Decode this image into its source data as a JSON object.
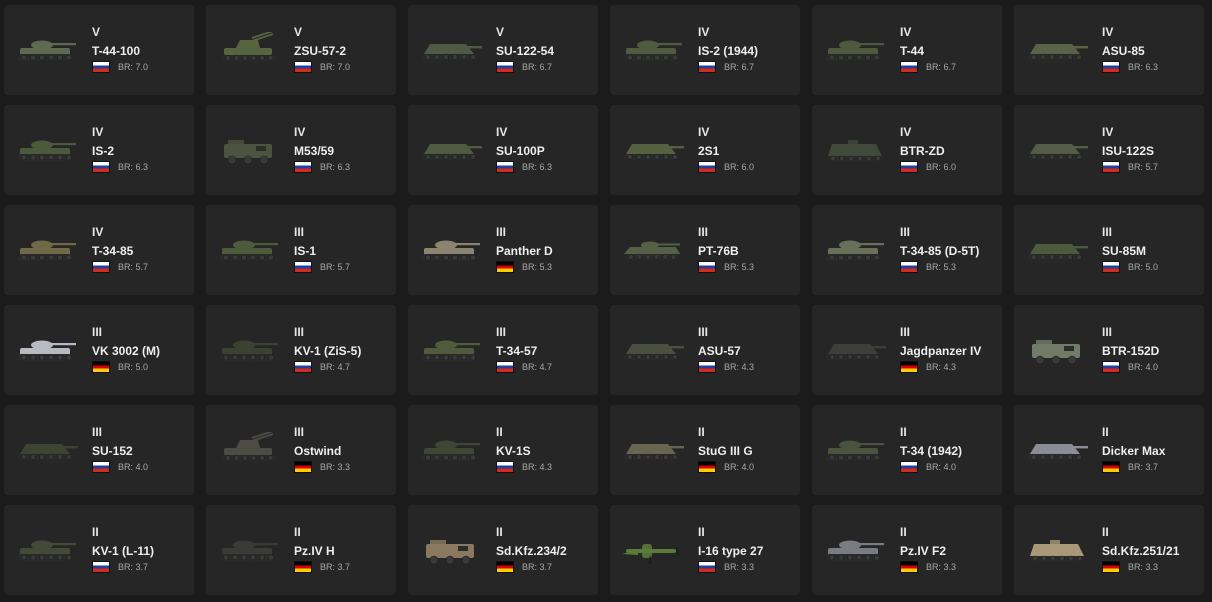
{
  "br_prefix": "BR: ",
  "nations": {
    "ussr": {
      "flag": "ussr-flag-icon",
      "colors": [
        "#ffffff",
        "#1c3fa0",
        "#d52b1e"
      ]
    },
    "germany": {
      "flag": "germany-flag-icon",
      "colors": [
        "#000000",
        "#dd0000",
        "#ffce00"
      ]
    }
  },
  "vehicles": [
    {
      "rank": "V",
      "name": "T-44-100",
      "nation": "ussr",
      "br": "7.0",
      "kind": "tank",
      "color": "#5e6b52"
    },
    {
      "rank": "V",
      "name": "ZSU-57-2",
      "nation": "ussr",
      "br": "7.0",
      "kind": "spaa",
      "color": "#56643f"
    },
    {
      "rank": "V",
      "name": "SU-122-54",
      "nation": "ussr",
      "br": "6.7",
      "kind": "td",
      "color": "#4e5a44"
    },
    {
      "rank": "IV",
      "name": "IS-2 (1944)",
      "nation": "ussr",
      "br": "6.7",
      "kind": "tank",
      "color": "#505c40"
    },
    {
      "rank": "IV",
      "name": "T-44",
      "nation": "ussr",
      "br": "6.7",
      "kind": "tank",
      "color": "#4d5a3e"
    },
    {
      "rank": "IV",
      "name": "ASU-85",
      "nation": "ussr",
      "br": "6.3",
      "kind": "td",
      "color": "#596348"
    },
    {
      "rank": "IV",
      "name": "IS-2",
      "nation": "ussr",
      "br": "6.3",
      "kind": "tank",
      "color": "#4c5a3c"
    },
    {
      "rank": "IV",
      "name": "M53/59",
      "nation": "ussr",
      "br": "6.3",
      "kind": "truck",
      "color": "#4c5440"
    },
    {
      "rank": "IV",
      "name": "SU-100P",
      "nation": "ussr",
      "br": "6.3",
      "kind": "spg",
      "color": "#4f5a40"
    },
    {
      "rank": "IV",
      "name": "2S1",
      "nation": "ussr",
      "br": "6.0",
      "kind": "spg",
      "color": "#55603e"
    },
    {
      "rank": "IV",
      "name": "BTR-ZD",
      "nation": "ussr",
      "br": "6.0",
      "kind": "apc",
      "color": "#3f4a3b"
    },
    {
      "rank": "IV",
      "name": "ISU-122S",
      "nation": "ussr",
      "br": "5.7",
      "kind": "td",
      "color": "#545c48"
    },
    {
      "rank": "IV",
      "name": "T-34-85",
      "nation": "ussr",
      "br": "5.7",
      "kind": "tank",
      "color": "#6f6a45"
    },
    {
      "rank": "III",
      "name": "IS-1",
      "nation": "ussr",
      "br": "5.7",
      "kind": "tank",
      "color": "#4d5a3c"
    },
    {
      "rank": "III",
      "name": "Panther D",
      "nation": "germany",
      "br": "5.3",
      "kind": "tank",
      "color": "#8a8470"
    },
    {
      "rank": "III",
      "name": "PT-76B",
      "nation": "ussr",
      "br": "5.3",
      "kind": "light",
      "color": "#566046"
    },
    {
      "rank": "III",
      "name": "T-34-85 (D-5T)",
      "nation": "ussr",
      "br": "5.3",
      "kind": "tank",
      "color": "#6a6f5a"
    },
    {
      "rank": "III",
      "name": "SU-85M",
      "nation": "ussr",
      "br": "5.0",
      "kind": "td",
      "color": "#4e5a3e"
    },
    {
      "rank": "III",
      "name": "VK 3002 (M)",
      "nation": "germany",
      "br": "5.0",
      "kind": "tank",
      "color": "#b8bac2"
    },
    {
      "rank": "III",
      "name": "KV-1 (ZiS-5)",
      "nation": "ussr",
      "br": "4.7",
      "kind": "tank",
      "color": "#3b4232"
    },
    {
      "rank": "III",
      "name": "T-34-57",
      "nation": "ussr",
      "br": "4.7",
      "kind": "tank",
      "color": "#505a3c"
    },
    {
      "rank": "III",
      "name": "ASU-57",
      "nation": "ussr",
      "br": "4.3",
      "kind": "spg",
      "color": "#4a4f40"
    },
    {
      "rank": "III",
      "name": "Jagdpanzer IV",
      "nation": "germany",
      "br": "4.3",
      "kind": "td",
      "color": "#3e3e3a"
    },
    {
      "rank": "III",
      "name": "BTR-152D",
      "nation": "ussr",
      "br": "4.0",
      "kind": "truck",
      "color": "#727a68"
    },
    {
      "rank": "III",
      "name": "SU-152",
      "nation": "ussr",
      "br": "4.0",
      "kind": "td",
      "color": "#3c4432"
    },
    {
      "rank": "III",
      "name": "Ostwind",
      "nation": "germany",
      "br": "3.3",
      "kind": "spaa",
      "color": "#4c4c44"
    },
    {
      "rank": "II",
      "name": "KV-1S",
      "nation": "ussr",
      "br": "4.3",
      "kind": "tank",
      "color": "#3e4634"
    },
    {
      "rank": "II",
      "name": "StuG III G",
      "nation": "germany",
      "br": "4.0",
      "kind": "td",
      "color": "#6a6550"
    },
    {
      "rank": "II",
      "name": "T-34 (1942)",
      "nation": "ussr",
      "br": "4.0",
      "kind": "tank",
      "color": "#4a5240"
    },
    {
      "rank": "II",
      "name": "Dicker Max",
      "nation": "germany",
      "br": "3.7",
      "kind": "td",
      "color": "#8a8c96"
    },
    {
      "rank": "II",
      "name": "KV-1 (L-11)",
      "nation": "ussr",
      "br": "3.7",
      "kind": "tank",
      "color": "#434a38"
    },
    {
      "rank": "II",
      "name": "Pz.IV H",
      "nation": "germany",
      "br": "3.7",
      "kind": "tank",
      "color": "#3a3a36"
    },
    {
      "rank": "II",
      "name": "Sd.Kfz.234/2",
      "nation": "germany",
      "br": "3.7",
      "kind": "truck",
      "color": "#8a7860"
    },
    {
      "rank": "II",
      "name": "I-16 type 27",
      "nation": "ussr",
      "br": "3.3",
      "kind": "plane",
      "color": "#5c7a3a"
    },
    {
      "rank": "II",
      "name": "Pz.IV F2",
      "nation": "germany",
      "br": "3.3",
      "kind": "tank",
      "color": "#7a7c84"
    },
    {
      "rank": "II",
      "name": "Sd.Kfz.251/21",
      "nation": "germany",
      "br": "3.3",
      "kind": "apc",
      "color": "#a89878"
    }
  ]
}
